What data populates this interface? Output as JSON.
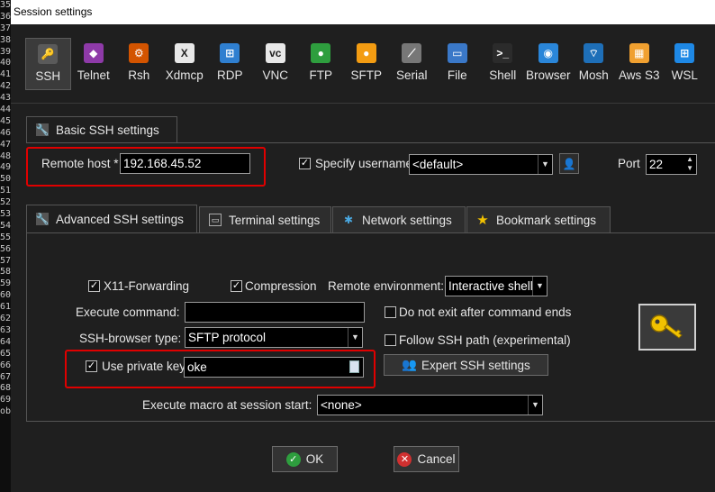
{
  "gutter_lines": [
    "35",
    "36",
    "37",
    "38",
    "39",
    "40",
    "41",
    "42",
    "43",
    "44",
    "45",
    "46",
    "47",
    "48",
    "49",
    "50",
    "51",
    "52",
    "53",
    "54",
    "55",
    "56",
    "57",
    "58",
    "59",
    "60",
    "61",
    "62",
    "63",
    "64",
    "65",
    "66",
    "67",
    "68",
    "69",
    "ob"
  ],
  "window": {
    "title": "Session settings"
  },
  "protocols": [
    {
      "label": "SSH",
      "icon": "ssh-icon",
      "color": "#5a5a5a",
      "glyph": "🔑"
    },
    {
      "label": "Telnet",
      "icon": "telnet-icon",
      "color": "#8e3aa8",
      "glyph": "◆"
    },
    {
      "label": "Rsh",
      "icon": "rsh-icon",
      "color": "#d35400",
      "glyph": "⚙"
    },
    {
      "label": "Xdmcp",
      "icon": "xdmcp-icon",
      "color": "#e8e8e8",
      "glyph": "X"
    },
    {
      "label": "RDP",
      "icon": "rdp-icon",
      "color": "#2f7fd0",
      "glyph": "⊞"
    },
    {
      "label": "VNC",
      "icon": "vnc-icon",
      "color": "#e8e8e8",
      "glyph": "vc"
    },
    {
      "label": "FTP",
      "icon": "ftp-icon",
      "color": "#2e9e3e",
      "glyph": "●"
    },
    {
      "label": "SFTP",
      "icon": "sftp-icon",
      "color": "#f39c12",
      "glyph": "●"
    },
    {
      "label": "Serial",
      "icon": "serial-icon",
      "color": "#777777",
      "glyph": "⟋"
    },
    {
      "label": "File",
      "icon": "file-icon",
      "color": "#3a78c8",
      "glyph": "▭"
    },
    {
      "label": "Shell",
      "icon": "shell-icon",
      "color": "#2b2b2b",
      "glyph": ">_"
    },
    {
      "label": "Browser",
      "icon": "browser-icon",
      "color": "#2a86d9",
      "glyph": "◉"
    },
    {
      "label": "Mosh",
      "icon": "mosh-icon",
      "color": "#1e6fb8",
      "glyph": "⌔"
    },
    {
      "label": "Aws S3",
      "icon": "aws-s3-icon",
      "color": "#f0a030",
      "glyph": "▦"
    },
    {
      "label": "WSL",
      "icon": "wsl-icon",
      "color": "#1e88e5",
      "glyph": "⊞"
    }
  ],
  "basic": {
    "tab_label": "Basic SSH settings",
    "remote_host_label": "Remote host *",
    "remote_host_value": "192.168.45.52",
    "specify_username_label": "Specify username",
    "specify_username_checked": "✓",
    "username_value": "<default>",
    "port_label": "Port",
    "port_value": "22"
  },
  "tabs": [
    {
      "label": "Advanced SSH settings",
      "icon": "wrench-icon"
    },
    {
      "label": "Terminal settings",
      "icon": "terminal-icon"
    },
    {
      "label": "Network settings",
      "icon": "network-icon"
    },
    {
      "label": "Bookmark settings",
      "icon": "star-icon"
    }
  ],
  "advanced": {
    "x11_label": "X11-Forwarding",
    "x11_checked": "✓",
    "compression_label": "Compression",
    "compression_checked": "✓",
    "remote_env_label": "Remote environment:",
    "remote_env_value": "Interactive shell",
    "execute_command_label": "Execute command:",
    "execute_command_value": "",
    "do_not_exit_label": "Do not exit after command ends",
    "ssh_browser_label": "SSH-browser type:",
    "ssh_browser_value": "SFTP protocol",
    "follow_ssh_label": "Follow SSH path (experimental)",
    "use_private_key_label": "Use private key",
    "use_private_key_checked": "✓",
    "private_key_value": "oke",
    "expert_button": "Expert SSH settings",
    "macro_label": "Execute macro at session start:",
    "macro_value": "<none>"
  },
  "buttons": {
    "ok": "OK",
    "cancel": "Cancel"
  },
  "colors": {
    "highlight": "#e00000",
    "ok_green": "#2e9e3e",
    "cancel_red": "#d03030",
    "key_yellow": "#f2c200"
  }
}
